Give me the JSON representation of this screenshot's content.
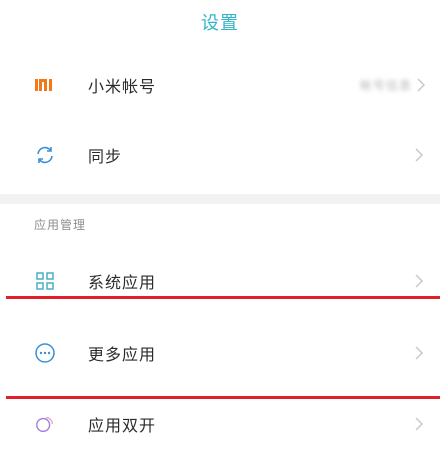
{
  "header": {
    "title": "设置"
  },
  "account_section": {
    "items": [
      {
        "label": "小米帐号",
        "value": "帐号信息",
        "icon": "mi-logo-icon",
        "icon_color": "#f07a1a"
      },
      {
        "label": "同步",
        "icon": "sync-icon",
        "icon_color": "#3a8fd6"
      }
    ]
  },
  "apps_section": {
    "header": "应用管理",
    "items": [
      {
        "label": "系统应用",
        "icon": "grid-icon",
        "icon_color": "#46b1c6"
      },
      {
        "label": "更多应用",
        "icon": "more-dots-icon",
        "icon_color": "#3a8fd6"
      },
      {
        "label": "应用双开",
        "icon": "dual-apps-icon",
        "icon_color": "#a07de0"
      }
    ]
  },
  "colors": {
    "accent": "#2fb7c9",
    "highlight_line": "#e2202a",
    "separator": "#f2f2f2"
  }
}
